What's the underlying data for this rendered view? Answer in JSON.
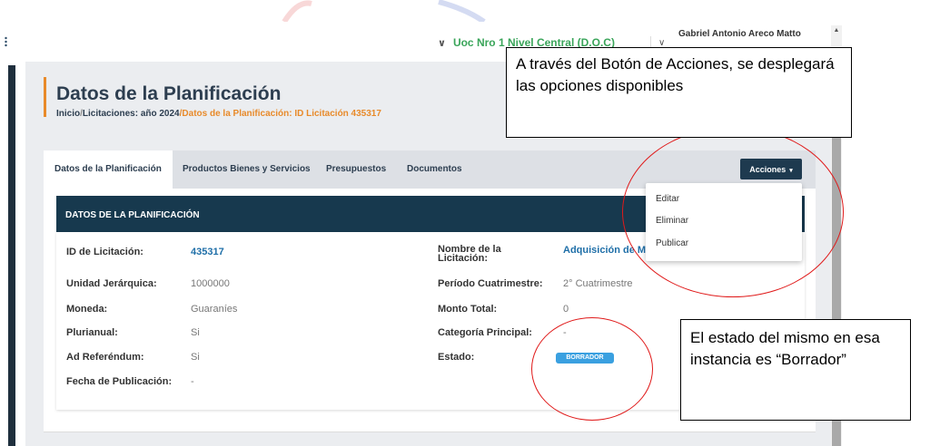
{
  "header": {
    "unit_selector": "Uoc Nro 1 Nivel Central (D.O.C)",
    "user_name": "Gabriel Antonio Areco Matto"
  },
  "page": {
    "title": "Datos de la Planificación",
    "breadcrumb": {
      "home": "Inicio",
      "sep1": "/",
      "section": "Licitaciones: año 2024",
      "sep2": "/",
      "current": "Datos de la Planificación: ID Licitación 435317"
    }
  },
  "tabs": [
    {
      "label": "Datos de la Planificación",
      "active": true
    },
    {
      "label": "Productos Bienes y Servicios",
      "active": false
    },
    {
      "label": "Presupuestos",
      "active": false
    },
    {
      "label": "Documentos",
      "active": false
    }
  ],
  "actions": {
    "label": "Acciones",
    "caret": "▾",
    "menu": [
      "Editar",
      "Eliminar",
      "Publicar"
    ]
  },
  "section": {
    "title": "DATOS DE LA PLANIFICACIÓN"
  },
  "fields": {
    "id_label": "ID de Licitación:",
    "id_value": "435317",
    "nombre_label": "Nombre de la Licitación:",
    "nombre_value": "Adquisición de Mu",
    "unidad_label": "Unidad Jerárquica:",
    "unidad_value": "1000000",
    "periodo_label": "Período Cuatrimestre:",
    "periodo_value": "2° Cuatrimestre",
    "moneda_label": "Moneda:",
    "moneda_value": "Guaraníes",
    "monto_label": "Monto Total:",
    "monto_value": "0",
    "plurianual_label": "Plurianual:",
    "plurianual_value": "Si",
    "categoria_label": "Categoría Principal:",
    "categoria_value": "-",
    "ad_label": "Ad Referéndum:",
    "ad_value": "Si",
    "estado_label": "Estado:",
    "estado_value": "BORRADOR",
    "fecha_label": "Fecha de Publicación:",
    "fecha_value": "-"
  },
  "annotations": {
    "callout_actions": "A través del Botón de Acciones, se desplegará las opciones disponibles",
    "callout_state": "El estado del mismo en esa instancia es “Borrador”"
  },
  "colors": {
    "navy": "#17394e",
    "accent_orange": "#e88a2a",
    "badge_blue": "#3aa0e0",
    "annotation_red": "#e01a1a",
    "unit_green": "#3aa55a"
  }
}
